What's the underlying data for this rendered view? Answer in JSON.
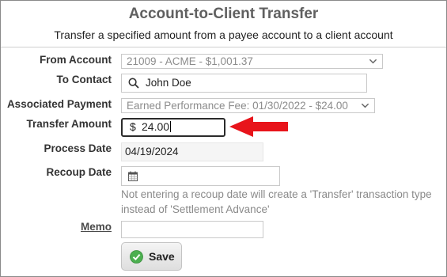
{
  "header": {
    "title": "Account-to-Client Transfer",
    "subtitle": "Transfer a specified amount from a payee account to a client account"
  },
  "form": {
    "from_account": {
      "label": "From Account",
      "value": "21009 - ACME - $1,001.37"
    },
    "to_contact": {
      "label": "To Contact",
      "value": "John Doe"
    },
    "associated_payment": {
      "label": "Associated Payment",
      "value": "Earned Performance Fee: 01/30/2022 - $24.00"
    },
    "transfer_amount": {
      "label": "Transfer Amount",
      "currency_symbol": "$",
      "value": "24.00"
    },
    "process_date": {
      "label": "Process Date",
      "value": "04/19/2024"
    },
    "recoup_date": {
      "label": "Recoup Date",
      "value": "",
      "help": "Not entering a recoup date will create a 'Transfer' transaction type instead of 'Settlement Advance'"
    },
    "memo": {
      "label": "Memo",
      "value": ""
    },
    "save_label": "Save"
  },
  "colors": {
    "title": "#606060",
    "annotation_arrow": "#e8141b",
    "save_check": "#4caf50"
  },
  "icons": {
    "select_chevron": "chevron-down-icon",
    "contact_search": "search-icon",
    "recoup_calendar": "calendar-icon",
    "save_check": "check-circle-icon",
    "annotation": "arrow-left-icon"
  }
}
